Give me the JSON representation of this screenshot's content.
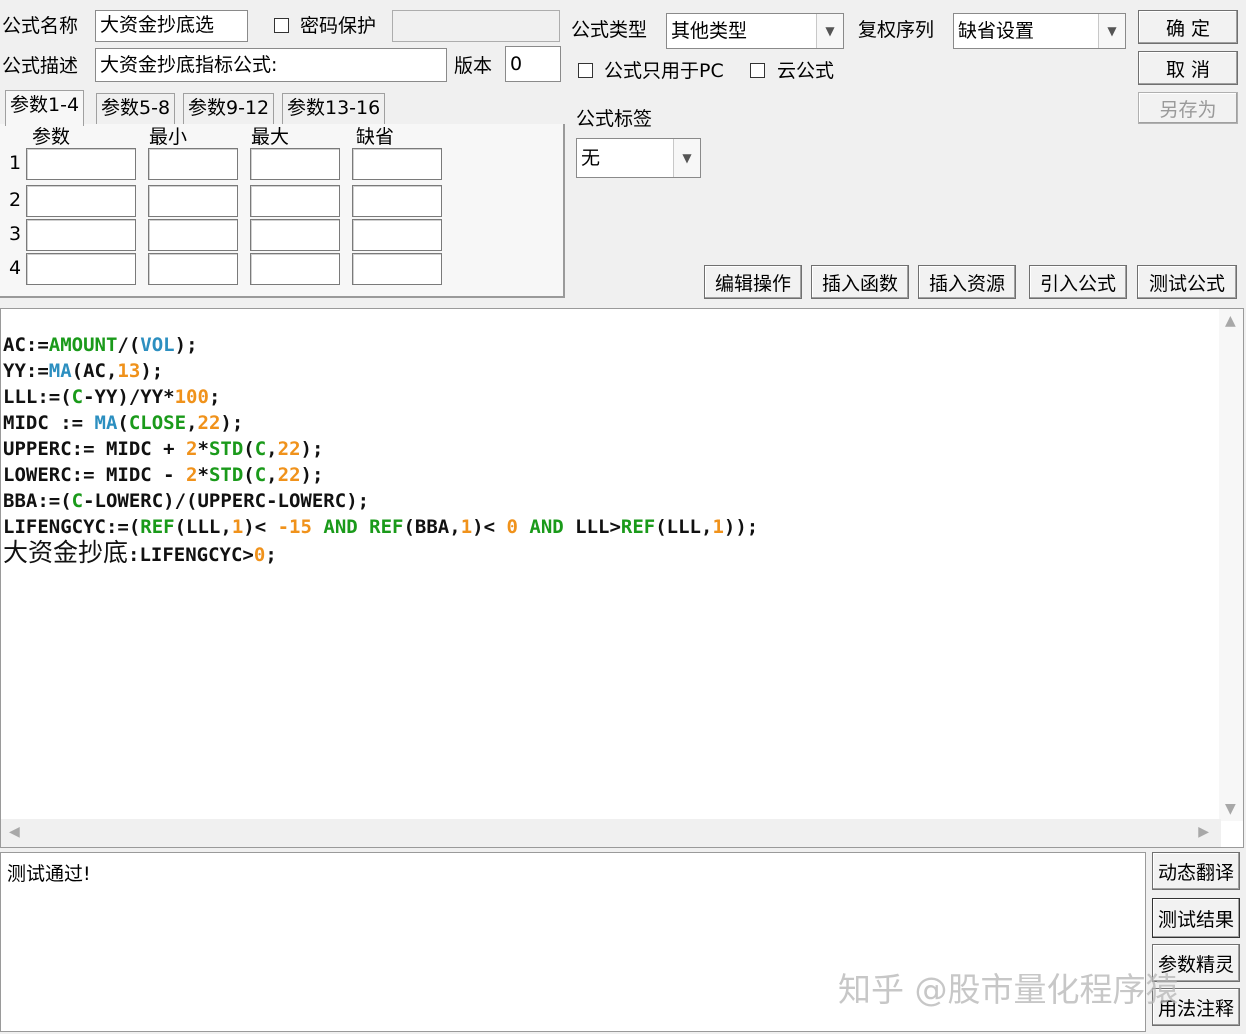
{
  "header": {
    "name_label": "公式名称",
    "name_value": "大资金抄底选",
    "password_label": "密码保护",
    "desc_label": "公式描述",
    "desc_value": "大资金抄底指标公式:",
    "version_label": "版本",
    "version_value": "0",
    "type_label": "公式类型",
    "type_value": "其他类型",
    "rights_label": "复权序列",
    "rights_value": "缺省设置",
    "pc_only_label": "公式只用于PC",
    "cloud_label": "云公式",
    "tag_label": "公式标签",
    "tag_value": "无"
  },
  "buttons": {
    "ok": "确  定",
    "cancel": "取  消",
    "save_as": "另存为",
    "edit_ops": "编辑操作",
    "insert_func": "插入函数",
    "insert_res": "插入资源",
    "import_formula": "引入公式",
    "test_formula": "测试公式",
    "dynamic_translate": "动态翻译",
    "test_result": "测试结果",
    "param_wizard": "参数精灵",
    "usage_notes": "用法注释"
  },
  "tabs": [
    "参数1-4",
    "参数5-8",
    "参数9-12",
    "参数13-16"
  ],
  "param_table": {
    "headers": [
      "参数",
      "最小",
      "最大",
      "缺省"
    ],
    "rows": [
      "1",
      "2",
      "3",
      "4"
    ]
  },
  "code_lines": [
    [
      [
        "bk",
        "AC:="
      ],
      [
        "gr",
        "AMOUNT"
      ],
      [
        "bk",
        "/("
      ],
      [
        "bl",
        "VOL"
      ],
      [
        "bk",
        ");"
      ]
    ],
    [
      [
        "bk",
        "YY:="
      ],
      [
        "bl",
        "MA"
      ],
      [
        "bk",
        "(AC,"
      ],
      [
        "or",
        "13"
      ],
      [
        "bk",
        ");"
      ]
    ],
    [
      [
        "bk",
        "LLL:=("
      ],
      [
        "gr",
        "C"
      ],
      [
        "bk",
        "-YY)/YY*"
      ],
      [
        "or",
        "100"
      ],
      [
        "bk",
        ";"
      ]
    ],
    [
      [
        "bk",
        "MIDC := "
      ],
      [
        "bl",
        "MA"
      ],
      [
        "bk",
        "("
      ],
      [
        "gr",
        "CLOSE"
      ],
      [
        "bk",
        ","
      ],
      [
        "or",
        "22"
      ],
      [
        "bk",
        ");"
      ]
    ],
    [
      [
        "bk",
        "UPPERC:= MIDC + "
      ],
      [
        "or",
        "2"
      ],
      [
        "bk",
        "*"
      ],
      [
        "gr",
        "STD"
      ],
      [
        "bk",
        "("
      ],
      [
        "gr",
        "C"
      ],
      [
        "bk",
        ","
      ],
      [
        "or",
        "22"
      ],
      [
        "bk",
        ");"
      ]
    ],
    [
      [
        "bk",
        "LOWERC:= MIDC - "
      ],
      [
        "or",
        "2"
      ],
      [
        "bk",
        "*"
      ],
      [
        "gr",
        "STD"
      ],
      [
        "bk",
        "("
      ],
      [
        "gr",
        "C"
      ],
      [
        "bk",
        ","
      ],
      [
        "or",
        "22"
      ],
      [
        "bk",
        ");"
      ]
    ],
    [
      [
        "bk",
        "BBA:=("
      ],
      [
        "gr",
        "C"
      ],
      [
        "bk",
        "-LOWERC)/(UPPERC-LOWERC);"
      ]
    ],
    [
      [
        "bk",
        "LIFENGCYC:=("
      ],
      [
        "gr",
        "REF"
      ],
      [
        "bk",
        "(LLL,"
      ],
      [
        "or",
        "1"
      ],
      [
        "bk",
        ")< "
      ],
      [
        "or",
        "-15"
      ],
      [
        "bk",
        " "
      ],
      [
        "gr",
        "AND"
      ],
      [
        "bk",
        " "
      ],
      [
        "gr",
        "REF"
      ],
      [
        "bk",
        "(BBA,"
      ],
      [
        "or",
        "1"
      ],
      [
        "bk",
        ")< "
      ],
      [
        "or",
        "0"
      ],
      [
        "bk",
        " "
      ],
      [
        "gr",
        "AND"
      ],
      [
        "bk",
        " LLL>"
      ],
      [
        "gr",
        "REF"
      ],
      [
        "bk",
        "(LLL,"
      ],
      [
        "or",
        "1"
      ],
      [
        "bk",
        "));"
      ]
    ],
    [
      [
        "cn",
        "大资金抄底"
      ],
      [
        "bk",
        ":LIFENGCYC>"
      ],
      [
        "or",
        "0"
      ],
      [
        "bk",
        ";"
      ]
    ]
  ],
  "output_text": "测试通过!",
  "watermark": "知乎 @股市量化程序猿",
  "colors": {
    "keyword_green": "#1a9a1a",
    "function_blue": "#2c8fc0",
    "number_orange": "#f0921b"
  }
}
